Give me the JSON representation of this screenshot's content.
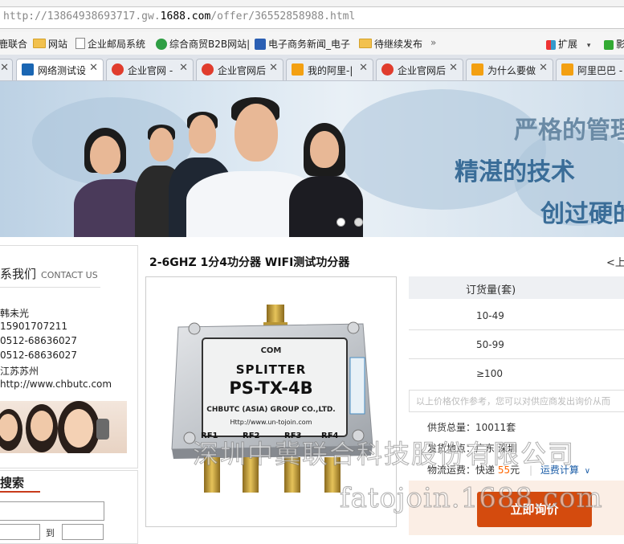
{
  "browser": {
    "url_prefix": "http://13864938693717.gw.",
    "url_domain": "1688.com",
    "url_suffix": "/offer/36552858988.html",
    "bookmarks": [
      {
        "label": "鹿联合",
        "icon": "star-icon"
      },
      {
        "label": "网站",
        "icon": "folder-icon"
      },
      {
        "label": "企业邮局系统",
        "icon": "page-icon"
      },
      {
        "label": "综合商贸B2B网站|",
        "icon": "e-icon"
      },
      {
        "label": "电子商务新闻_电子",
        "icon": "news-icon"
      },
      {
        "label": "待继续发布",
        "icon": "folder-icon"
      },
      {
        "label": "»",
        "icon": "more-icon"
      }
    ],
    "extensions_label": "扩展",
    "extensions_arrow": "▾",
    "video_label": "影",
    "tabs": [
      {
        "label": "网络测试设",
        "active": true
      },
      {
        "label": "企业官网 -"
      },
      {
        "label": "企业官网后"
      },
      {
        "label": "我的阿里-|"
      },
      {
        "label": "企业官网后"
      },
      {
        "label": "为什么要做"
      },
      {
        "label": "阿里巴巴 -"
      }
    ],
    "close_glyph": "✕"
  },
  "banner": {
    "slogan1": "严格的管理",
    "slogan2": "精湛的技术",
    "slogan3": "创过硬的"
  },
  "sidebar": {
    "contact_title": "系我们",
    "contact_sub": "CONTACT US",
    "lines": [
      "韩未光",
      "15901707211",
      "0512-68636027",
      "0512-68636027",
      "江苏苏州",
      "http://www.chbutc.com"
    ],
    "search_title": "搜索",
    "to_label": "到"
  },
  "product": {
    "title": "2-6GHZ 1分4功分器 WIFI测试功分器",
    "prev": "<上一",
    "device": {
      "brand": "COM",
      "name1": "SPLITTER",
      "model": "PS-TX-4B",
      "company": "CHBUTC (ASIA) GROUP CO.,LTD.",
      "website": "Http://www.un-tojoin.com",
      "ports": [
        "RF1",
        "RF2",
        "RF3",
        "RF4"
      ]
    },
    "table_header": "订货量(套)",
    "rows": [
      "10-49",
      "50-99",
      "≥100"
    ],
    "note": "以上价格仅作参考，您可以对供应商发出询价从而",
    "supply_label": "供货总量：",
    "supply_value": "10011套",
    "ship_label": "发货地点：",
    "ship_value": "广东 深圳",
    "fee_label": "物流运费：",
    "fee_value_prefix": "快递",
    "fee_value_num": "55",
    "fee_value_suffix": "元",
    "fee_calc": "运费计算",
    "fee_calc_arrow": "∨",
    "ask_button": "立即询价"
  },
  "watermark": {
    "line1": "深圳中冀联合科技股份有限公司",
    "line2": "fatojoin.1688.com"
  },
  "colors": {
    "accent": "#d44b0e",
    "link": "#1a5ca7",
    "slogan": "#3a6d98"
  }
}
